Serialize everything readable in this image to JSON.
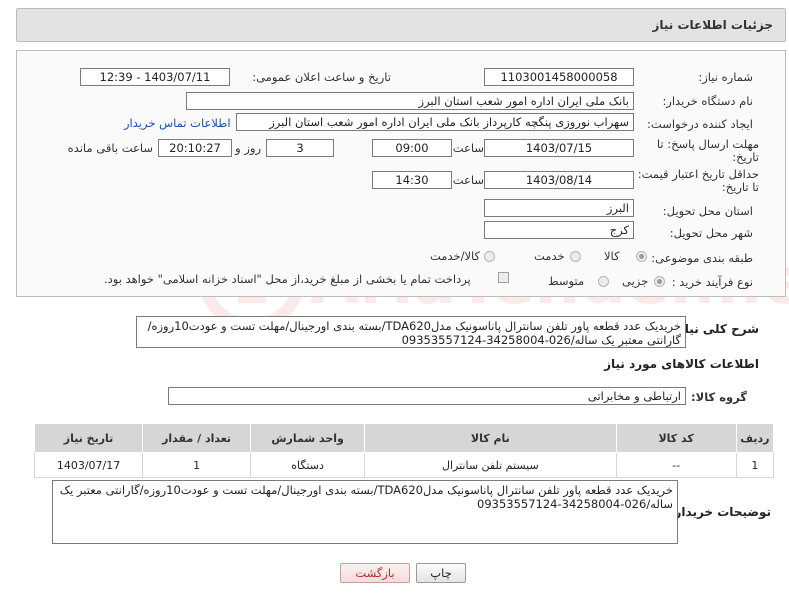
{
  "header": {
    "title": "جزئیات اطلاعات نیاز"
  },
  "form": {
    "need_number": {
      "label": "شماره نیاز:",
      "value": "1103001458000058"
    },
    "announce_datetime": {
      "label": "تاریخ و ساعت اعلان عمومی:",
      "value": "1403/07/11 - 12:39"
    },
    "buyer_org": {
      "label": "نام دستگاه خریدار:",
      "value": "بانک ملی ایران اداره امور شعب استان البرز"
    },
    "requester": {
      "label": "ایجاد کننده درخواست:",
      "value": "سهراب نوروزی پنگچه کارپرداز بانک ملی ایران اداره امور شعب استان البرز",
      "contact_link": "اطلاعات تماس خریدار"
    },
    "reply_deadline": {
      "label": "مهلت ارسال پاسخ: تا تاریخ:",
      "date": "1403/07/15",
      "time_label": "ساعت",
      "time": "09:00",
      "days": "3",
      "days_label": "روز و",
      "remaining": "20:10:27",
      "remaining_label": "ساعت باقی مانده"
    },
    "price_validity": {
      "label": "حداقل تاریخ اعتبار قیمت: تا تاریخ:",
      "date": "1403/08/14",
      "time_label": "ساعت",
      "time": "14:30"
    },
    "province": {
      "label": "استان محل تحویل:",
      "value": "البرز"
    },
    "city": {
      "label": "شهر محل تحویل:",
      "value": "کرج"
    },
    "category": {
      "label": "طبقه بندی موضوعی:",
      "options": [
        "کالا",
        "خدمت",
        "کالا/خدمت"
      ],
      "selected": "کالا"
    },
    "process_type": {
      "label": "نوع فرآیند خرید :",
      "options": [
        "جزیی",
        "متوسط"
      ],
      "selected": "جزیی",
      "note": "پرداخت تمام یا بخشی از مبلغ خرید،از محل \"اسناد خزانه اسلامی\" خواهد بود."
    }
  },
  "description": {
    "label": "شرح کلی نیاز:",
    "text": "خریدیک عدد قطعه پاور تلفن سانترال پاناسونیک مدلTDA620/بسته بندی اورجینال/مهلت تست و عودت10روزه/گارانتی معتبر یک ساله/026-34258004-09353557124"
  },
  "goods_section": {
    "title": "اطلاعات کالاهای مورد نیاز"
  },
  "goods_group": {
    "label": "گروه کالا:",
    "value": "ارتباطی و مخابراتی"
  },
  "table": {
    "headers": [
      "ردیف",
      "کد کالا",
      "نام کالا",
      "واحد شمارش",
      "تعداد / مقدار",
      "تاریخ نیاز"
    ],
    "rows": [
      {
        "row": "1",
        "code": "--",
        "name": "سیستم تلفن سانترال",
        "unit": "دستگاه",
        "qty": "1",
        "date": "1403/07/17"
      }
    ]
  },
  "buyer_notes": {
    "label": "توضیحات خریدار:",
    "text": "خریدیک عدد قطعه پاور تلفن سانترال پاناسونیک مدلTDA620/بسته بندی اورجینال/مهلت تست و عودت10روزه/گارانتی معتبر یک ساله/026-34258004-09353557124"
  },
  "buttons": {
    "print": "چاپ",
    "back": "بازگشت"
  },
  "watermark": {
    "text": "AriaTender.neT"
  }
}
